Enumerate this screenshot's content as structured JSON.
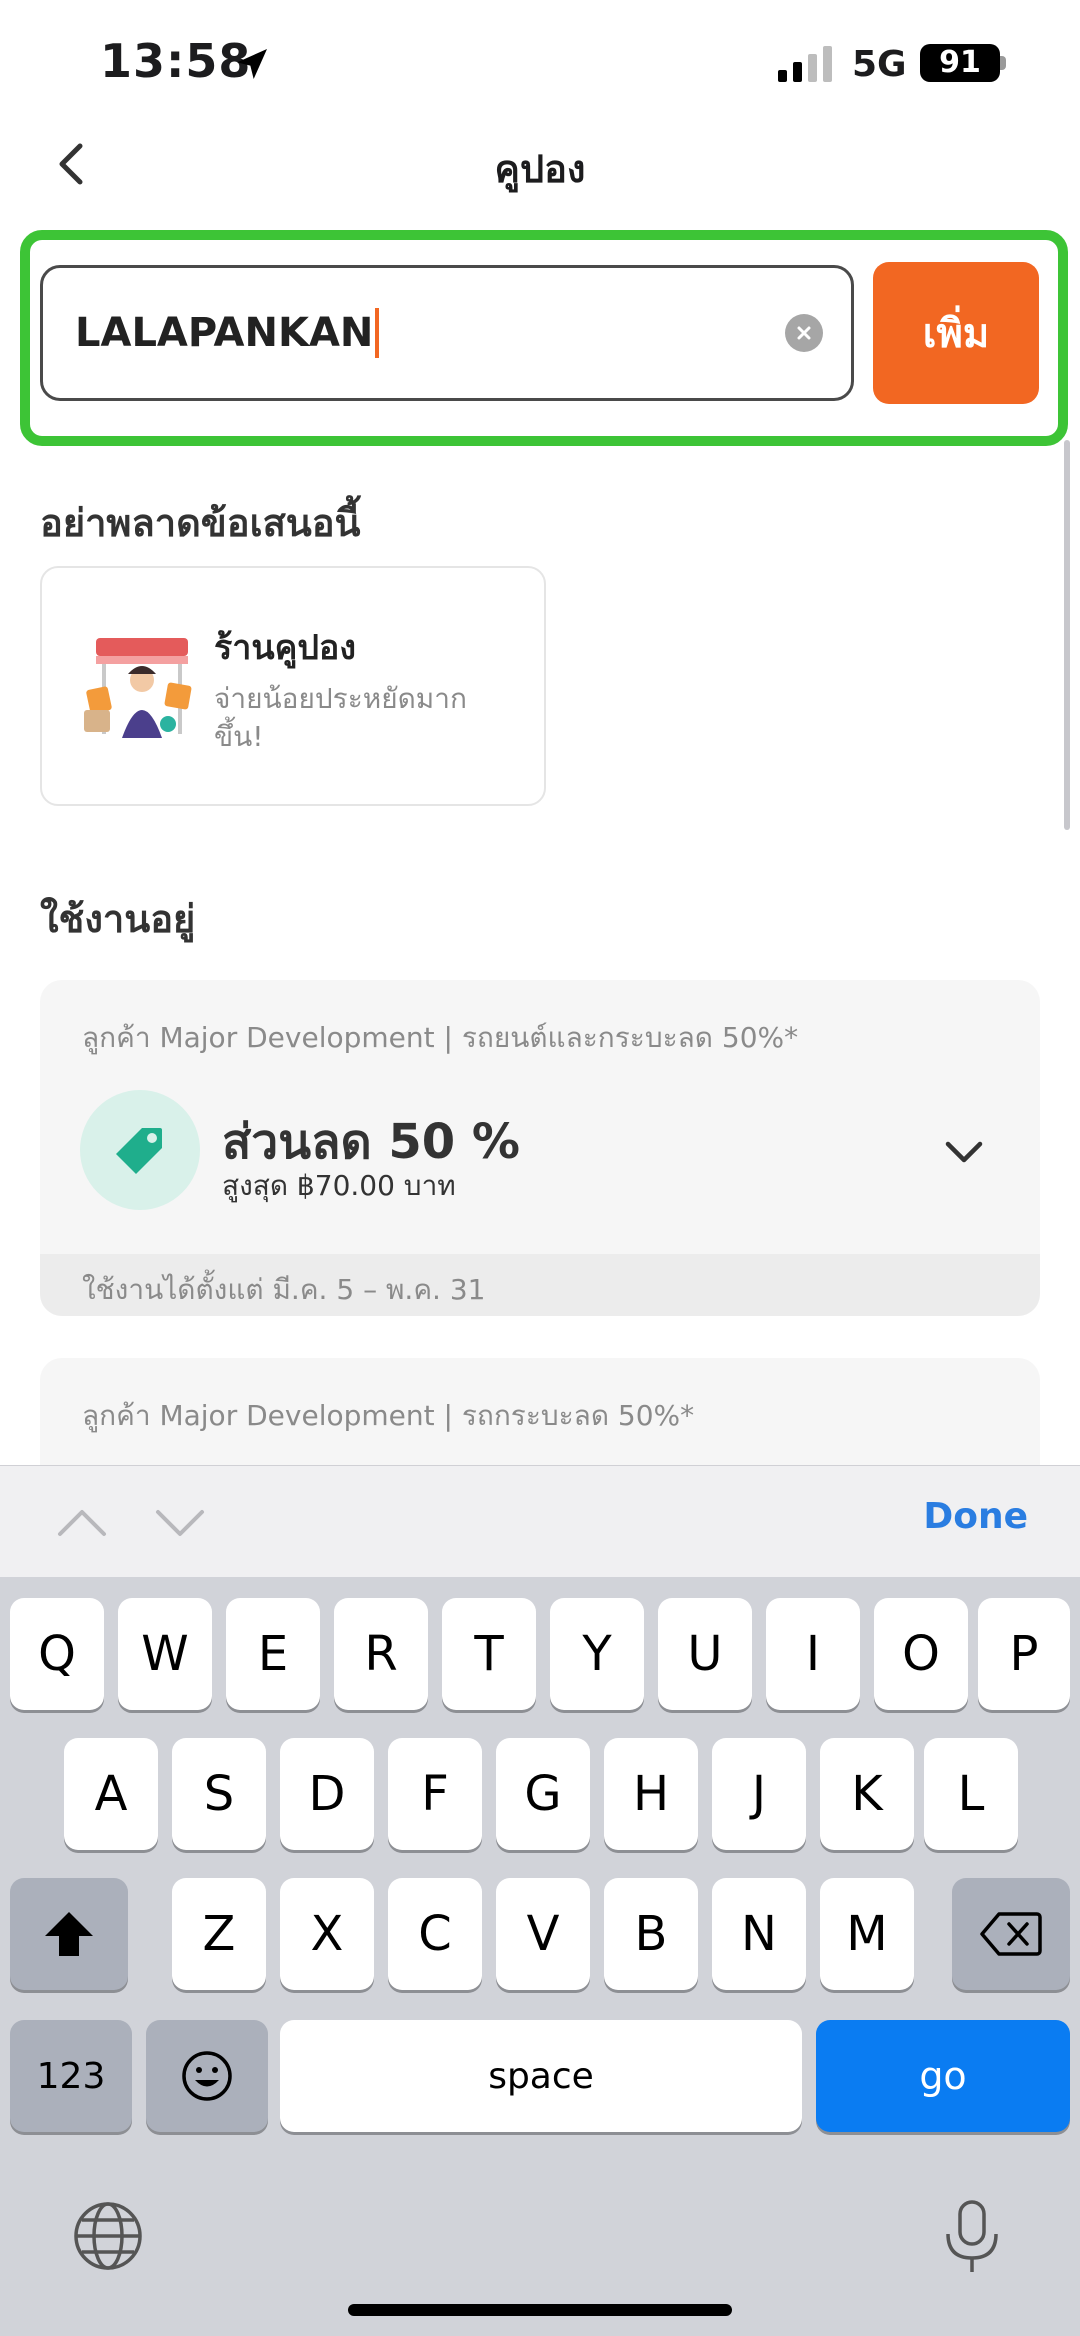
{
  "status_bar": {
    "time": "13:58",
    "network": "5G",
    "battery": "91"
  },
  "header": {
    "title": "คูปอง"
  },
  "coupon_input": {
    "value": "LALAPANKAN",
    "add_label": "เพิ่ม"
  },
  "offers": {
    "section_title": "อย่าพลาดข้อเสนอนี้",
    "shop": {
      "title": "ร้านคูปอง",
      "subtitle": "จ่ายน้อยประหยัดมากขึ้น!"
    }
  },
  "active": {
    "section_title": "ใช้งานอยู่",
    "coupons": [
      {
        "label": "ลูกค้า Major Development | รถยนต์และกระบะลด 50%*",
        "discount": "ส่วนลด 50 %",
        "max": "สูงสุด ฿70.00 บาท",
        "validity": "ใช้งานได้ตั้งแต่ มี.ค. 5 – พ.ค. 31"
      },
      {
        "label": "ลูกค้า Major Development | รถกระบะลด 50%*"
      }
    ]
  },
  "keyboard": {
    "done_label": "Done",
    "row1": [
      "Q",
      "W",
      "E",
      "R",
      "T",
      "Y",
      "U",
      "I",
      "O",
      "P"
    ],
    "row2": [
      "A",
      "S",
      "D",
      "F",
      "G",
      "H",
      "J",
      "K",
      "L"
    ],
    "row3": [
      "Z",
      "X",
      "C",
      "V",
      "B",
      "N",
      "M"
    ],
    "numbers_label": "123",
    "space_label": "space",
    "go_label": "go"
  },
  "colors": {
    "accent": "#f26722",
    "highlight": "#3dc436",
    "tag": "#1fae8c",
    "go": "#0a7cf2"
  }
}
